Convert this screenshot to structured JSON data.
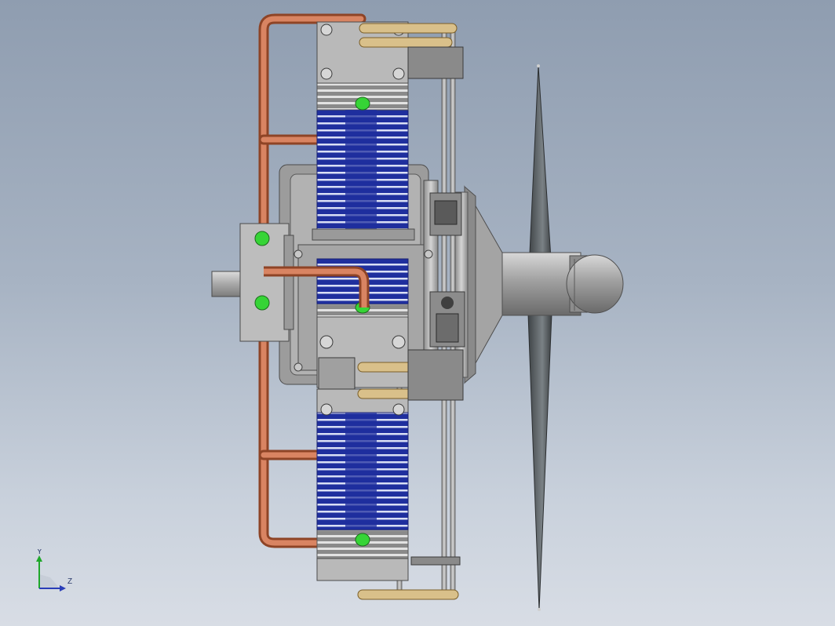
{
  "view": {
    "background_top": "#8f9db0",
    "background_bottom": "#d8dde5"
  },
  "colors": {
    "cylinder_blue": "#1f2f9e",
    "fin_light": "#cfd6f0",
    "metal_gray": "#b8b8b8",
    "metal_dark": "#6f6f6f",
    "copper": "#c06a44",
    "brass": "#d9c08a",
    "green_fitting": "#36d436",
    "propeller": "#555b5e"
  },
  "triad": {
    "y_label": "Y",
    "z_label": "Z",
    "y_color": "#1fa82a",
    "z_color": "#2a3eb8"
  }
}
